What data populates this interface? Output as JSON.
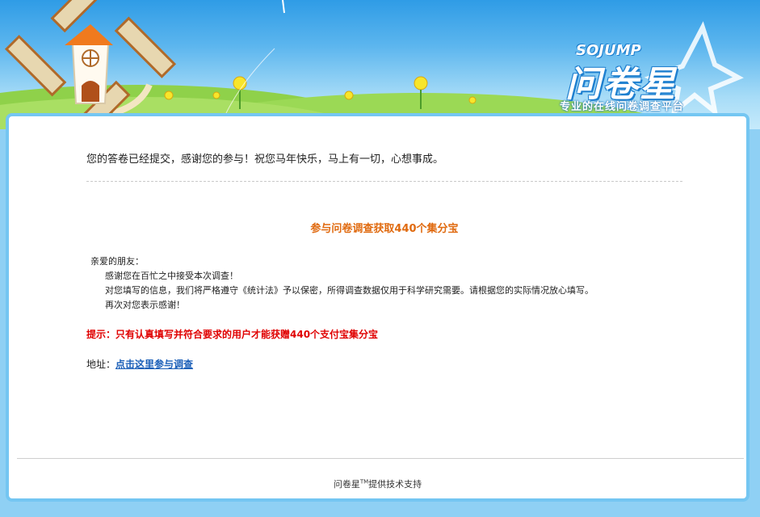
{
  "brand": {
    "logo_en": "SOJUMP",
    "logo_cn": "问卷星",
    "slogan": "专业的在线问卷调查平台"
  },
  "message": {
    "thanks": "您的答卷已经提交，感谢您的参与！祝您马年快乐，马上有一切，心想事成。"
  },
  "survey": {
    "title": "参与问卷调查获取440个集分宝",
    "greeting": "亲爱的朋友：",
    "lines": [
      "感谢您在百忙之中接受本次调查！",
      "对您填写的信息，我们将严格遵守《统计法》予以保密，所得调查数据仅用于科学研究需要。请根据您的实际情况放心填写。",
      "再次对您表示感谢！"
    ],
    "tip": "提示：只有认真填写并符合要求的用户才能获赠440个支付宝集分宝",
    "address_label": "地址：",
    "link_text": "点击这里参与调查"
  },
  "footer": {
    "brand": "问卷星",
    "tm": "TM",
    "text": "提供技术支持"
  },
  "colors": {
    "card_border": "#74c6f2",
    "title_orange": "#e06a0f",
    "tip_red": "#e00000",
    "link_blue": "#1b5fb8"
  }
}
